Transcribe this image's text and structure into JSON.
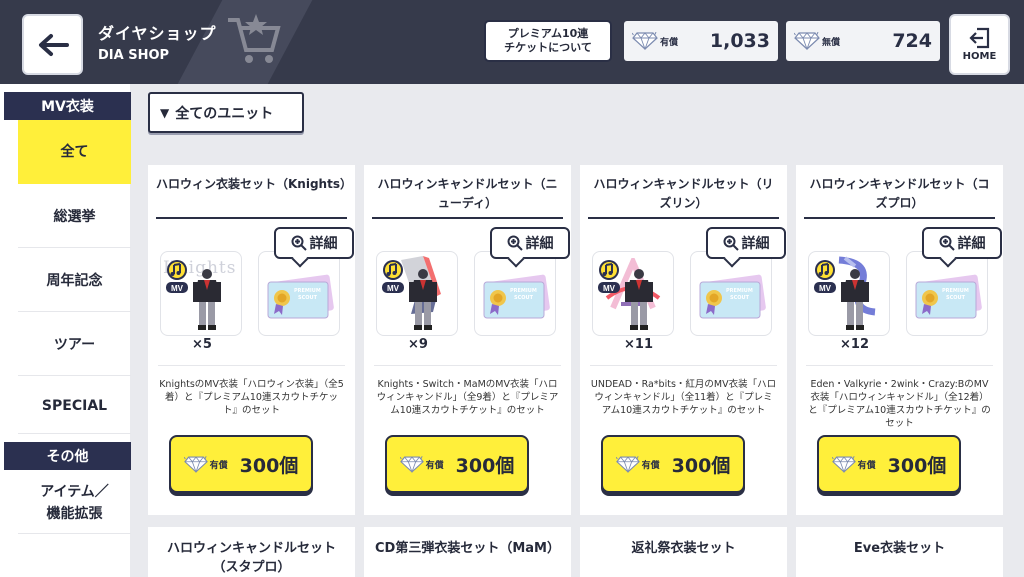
{
  "header": {
    "title": "ダイヤショップ",
    "subtitle": "DIA SHOP",
    "premium_info": [
      "プレミアム10連",
      "チケットについて"
    ],
    "paid_label": "有償",
    "paid_value": "1,033",
    "free_label": "無償",
    "free_value": "724",
    "home_label": "HOME"
  },
  "sidebar": {
    "section1": "MV衣装",
    "items": [
      "全て",
      "総選挙",
      "周年記念",
      "ツアー",
      "SPECIAL"
    ],
    "section2": "その他",
    "items2": [
      "アイテム／機能拡張"
    ]
  },
  "filter": {
    "label": "全てのユニット"
  },
  "cards": [
    {
      "title": "ハロウィン衣装セット（Knights）",
      "detail": "詳細",
      "count": "×5",
      "desc": "KnightsのMV衣装「ハロウィン衣装」（全5着）と『プレミアム10連スカウトチケット』のセット",
      "price_label": "有償",
      "price": "300個"
    },
    {
      "title": "ハロウィンキャンドルセット（ニューディ）",
      "detail": "詳細",
      "count": "×9",
      "desc": "Knights・Switch・MaMのMV衣装「ハロウィンキャンドル」（全9着）と『プレミアム10連スカウトチケット』のセット",
      "price_label": "有償",
      "price": "300個"
    },
    {
      "title": "ハロウィンキャンドルセット（リズリン）",
      "detail": "詳細",
      "count": "×11",
      "desc": "UNDEAD・Ra*bits・紅月のMV衣装「ハロウィンキャンドル」（全11着）と『プレミアム10連スカウトチケット』のセット",
      "price_label": "有償",
      "price": "300個"
    },
    {
      "title": "ハロウィンキャンドルセット（コズプロ）",
      "detail": "詳細",
      "count": "×12",
      "desc": "Eden・Valkyrie・2wink・Crazy:BのMV衣装「ハロウィンキャンドル」（全12着）と『プレミアム10連スカウトチケット』のセット",
      "price_label": "有償",
      "price": "300個"
    }
  ],
  "cards_row2": [
    "ハロウィンキャンドルセット（スタプロ）",
    "CD第三弾衣装セット（MaM）",
    "返礼祭衣装セット",
    "Eve衣装セット"
  ],
  "thumb_text": {
    "knights": "Knights",
    "ticket_line1": "PREMIUM",
    "ticket_line2": "SCOUT"
  },
  "colors": {
    "header": "#363a4b",
    "accent": "#ffef3a",
    "navy": "#2b3050"
  }
}
